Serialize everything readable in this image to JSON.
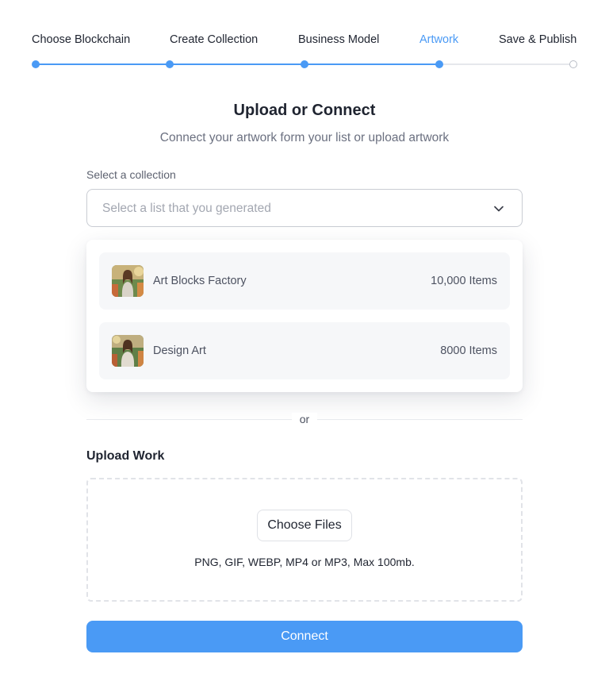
{
  "stepper": {
    "steps": [
      {
        "label": "Choose Blockchain",
        "state": "done"
      },
      {
        "label": "Create Collection",
        "state": "done"
      },
      {
        "label": "Business Model",
        "state": "done"
      },
      {
        "label": "Artwork",
        "state": "active"
      },
      {
        "label": "Save & Publish",
        "state": "pending"
      }
    ]
  },
  "header": {
    "title": "Upload or Connect",
    "subtitle": "Connect your artwork form your list or upload artwork"
  },
  "collection_select": {
    "label": "Select a collection",
    "placeholder": "Select a list that you generated",
    "options": [
      {
        "name": "Art Blocks Factory",
        "count": "10,000 Items",
        "icon": "collection-thumbnail"
      },
      {
        "name": "Design Art",
        "count": "8000 Items",
        "icon": "collection-thumbnail"
      }
    ]
  },
  "divider": {
    "text": "or"
  },
  "upload": {
    "title": "Upload Work",
    "button_label": "Choose Files",
    "formats": "PNG, GIF, WEBP, MP4 or MP3, Max 100mb."
  },
  "connect_button": {
    "label": "Connect"
  },
  "colors": {
    "accent": "#4a9af5",
    "text": "#1f2430",
    "muted": "#6b7080",
    "track": "#e6e8ec"
  }
}
